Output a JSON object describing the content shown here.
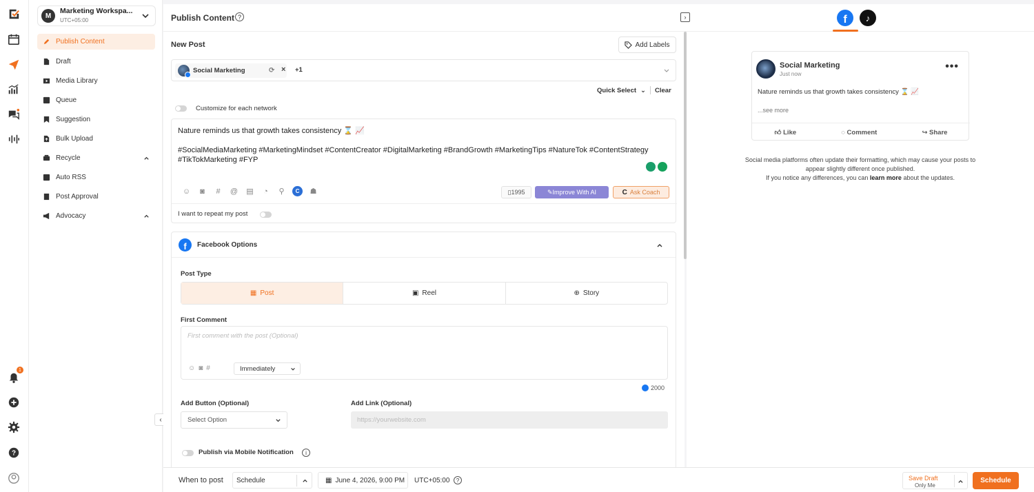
{
  "workspace": {
    "initial": "M",
    "name": "Marketing Workspa...",
    "timezone": "UTC+05:00"
  },
  "nav": {
    "items": [
      {
        "label": "Publish Content"
      },
      {
        "label": "Draft"
      },
      {
        "label": "Media Library"
      },
      {
        "label": "Queue"
      },
      {
        "label": "Suggestion"
      },
      {
        "label": "Bulk Upload"
      },
      {
        "label": "Recycle"
      },
      {
        "label": "Auto RSS"
      },
      {
        "label": "Post Approval"
      },
      {
        "label": "Advocacy"
      }
    ]
  },
  "rail": {
    "notification_count": "1"
  },
  "header": {
    "title": "Publish Content",
    "help": "?"
  },
  "preview_tabs": [
    "facebook-icon",
    "tiktok-icon"
  ],
  "editor": {
    "heading": "New Post",
    "add_labels": "Add Labels",
    "account_chip": "Social Marketing",
    "extra_accounts": "+1",
    "quick_select": "Quick Select",
    "clear": "Clear",
    "customize_label": "Customize for each network",
    "post_line1": "Nature reminds us that growth takes consistency ⌛ 📈",
    "post_line2": "#SocialMediaMarketing #MarketingMindset #ContentCreator #DigitalMarketing #BrandGrowth #MarketingTips #NatureTok #ContentStrategy #TikTokMarketing #FYP",
    "char_count": "1995",
    "improve_ai": "Improve With AI",
    "ask_coach": "Ask Coach",
    "repeat_label": "I want to repeat my post"
  },
  "facebook_options": {
    "title": "Facebook Options",
    "post_type_label": "Post Type",
    "post_types": [
      "Post",
      "Reel",
      "Story"
    ],
    "first_comment_label": "First Comment",
    "first_comment_placeholder": "First comment with the post (Optional)",
    "timing": "Immediately",
    "comment_limit": "2000",
    "add_button_label": "Add Button (Optional)",
    "add_button_placeholder": "Select Option",
    "add_link_label": "Add Link (Optional)",
    "add_link_placeholder": "https://yourwebsite.com",
    "mobile_notification": "Publish via Mobile Notification"
  },
  "bottom": {
    "when_label": "When to post",
    "schedule_mode": "Schedule",
    "date": "June 4, 2026, 9:00 PM",
    "timezone": "UTC+05:00",
    "save_draft": "Save Draft",
    "save_sub": "Only Me",
    "schedule_button": "Schedule"
  },
  "preview": {
    "page_name": "Social Marketing",
    "time": "Just now",
    "text": "Nature reminds us that growth takes consistency ⌛ 📈",
    "see_more": "...see more",
    "like": "Like",
    "comment": "Comment",
    "share": "Share",
    "note_line1": "Social media platforms often update their formatting, which may cause your posts to appear slightly different once published.",
    "note_line2a": "If you notice any differences, you can ",
    "note_link": "learn more",
    "note_line2b": " about the updates."
  },
  "colors": {
    "accent": "#f0701f",
    "facebook": "#1877f2",
    "ai": "#8b86d6"
  }
}
